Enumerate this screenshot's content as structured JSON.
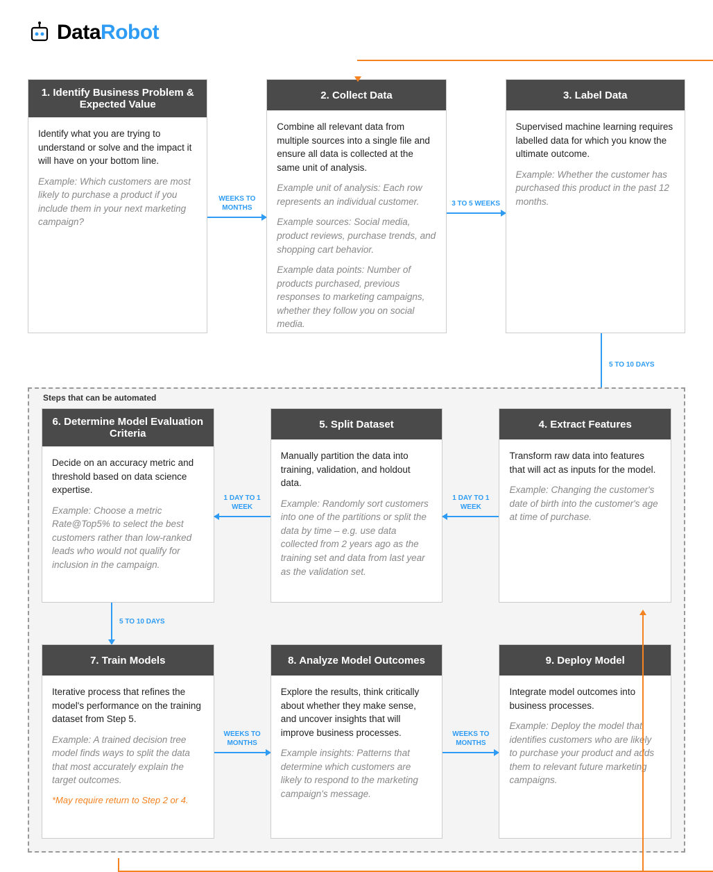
{
  "brand": {
    "data": "Data",
    "robot": "Robot"
  },
  "automation_box_label": "Steps that can be automated",
  "steps": {
    "s1": {
      "title": "1. Identify Business Problem & Expected Value",
      "desc": "Identify what you are trying to understand or solve and the impact it will have on your bottom line.",
      "example": "Example: Which customers are most likely to purchase a product if you include them in your next marketing campaign?"
    },
    "s2": {
      "title": "2. Collect Data",
      "desc": "Combine all relevant data from multiple sources into a single file and ensure all data is collected at the same unit of analysis.",
      "ex1": "Example unit of analysis: Each row represents an individual customer.",
      "ex2": "Example sources: Social media, product reviews, purchase trends, and shopping cart behavior.",
      "ex3": "Example data points: Number of products purchased, previous responses to marketing campaigns, whether they follow you on social media."
    },
    "s3": {
      "title": "3. Label Data",
      "desc": "Supervised machine learning requires labelled data for which you know the ultimate outcome.",
      "example": "Example: Whether the customer has purchased this product in the past 12 months."
    },
    "s4": {
      "title": "4. Extract Features",
      "desc": "Transform raw data into features that will act as inputs for the model.",
      "example": "Example: Changing the customer's date of birth into the customer's age at time of purchase."
    },
    "s5": {
      "title": "5. Split Dataset",
      "desc": "Manually partition the data into training, validation, and holdout data.",
      "example": "Example: Randomly sort customers into one of the partitions or split the data by time – e.g. use data collected from 2 years ago as the training set and data from last year as the validation set."
    },
    "s6": {
      "title": "6. Determine Model Evaluation Criteria",
      "desc": "Decide on an accuracy metric and threshold based on data science expertise.",
      "example": "Example: Choose a metric Rate@Top5% to select the best customers rather than low-ranked leads who would not qualify for inclusion in the campaign."
    },
    "s7": {
      "title": "7. Train Models",
      "desc": "Iterative process that refines the model's performance on the training dataset from Step 5.",
      "example": "Example: A trained decision tree model finds ways to split the data that most accurately explain the target outcomes.",
      "note": "*May require return to Step 2 or 4."
    },
    "s8": {
      "title": "8. Analyze Model Outcomes",
      "desc": "Explore the results, think critically about whether they make sense, and uncover insights that will improve business processes.",
      "example": "Example insights: Patterns that determine which customers are likely to respond to the marketing campaign's message."
    },
    "s9": {
      "title": "9. Deploy Model",
      "desc": "Integrate model outcomes into business processes.",
      "example": "Example: Deploy the model that identifies customers who are likely to purchase your product and adds them to relevant future marketing campaigns."
    }
  },
  "connectors": {
    "c12": "WEEKS TO MONTHS",
    "c23": "3 TO 5 WEEKS",
    "c34": "5 TO 10 DAYS",
    "c45": "1 DAY TO 1 WEEK",
    "c56": "1 DAY TO 1 WEEK",
    "c67": "5 TO 10 DAYS",
    "c78": "WEEKS TO MONTHS",
    "c89": "WEEKS TO MONTHS"
  }
}
